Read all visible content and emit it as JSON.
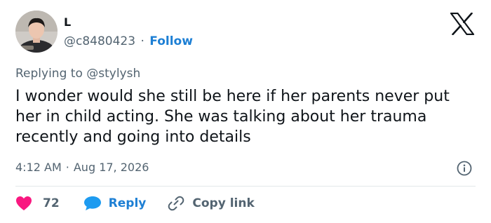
{
  "author": {
    "name": "L",
    "handle": "@c8480423",
    "separator": "·",
    "follow_label": "Follow"
  },
  "reply_context": {
    "prefix": "Replying to",
    "mention": "@stylysh"
  },
  "tweet": {
    "text": "I wonder would she still be here if her parents never put her in child acting. She was talking about her trauma recently and going into details",
    "time": "4:12 AM",
    "separator": "·",
    "date": "Aug 17, 2026"
  },
  "actions": {
    "like_count": "72",
    "reply_label": "Reply",
    "copy_link_label": "Copy link"
  },
  "colors": {
    "text": "#0f1419",
    "secondary": "#536471",
    "link": "#1d7fd4",
    "heart": "#f91880",
    "reply_bubble": "#1d9bf0"
  },
  "icons": {
    "brand": "x-logo-icon",
    "info": "info-icon",
    "like": "heart-icon",
    "reply": "speech-bubble-icon",
    "copy": "link-icon"
  }
}
